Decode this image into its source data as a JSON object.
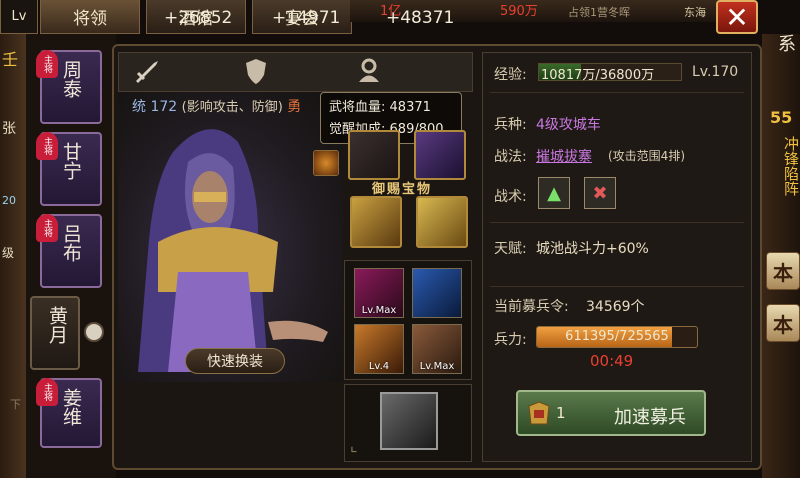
{
  "top_tabs": {
    "generals": "将领",
    "tavern": "酒馆",
    "banquet": "宴会"
  },
  "top_bar": {
    "res1": "1亿",
    "res2": "590万",
    "location": "东海",
    "misc": "占领1营冬晖"
  },
  "corner_labels": {
    "top_left": "Lv",
    "left_top": "壬",
    "left_mid": "张",
    "left_num": "20",
    "left_lvl": "级",
    "left_bottom": "下"
  },
  "hero_list": [
    {
      "name": "周泰",
      "badge": "主将"
    },
    {
      "name": "甘宁",
      "badge": "主将"
    },
    {
      "name": "吕布",
      "badge": "主将"
    },
    {
      "name": "黄月",
      "badge": ""
    },
    {
      "name": "姜维",
      "badge": "主将"
    }
  ],
  "stats": {
    "attack": "+26852",
    "defense": "+14971",
    "hp": "+48371"
  },
  "tongshuai": {
    "label": "统",
    "value": "172",
    "desc": "(影响攻击、防御)",
    "partial": "勇"
  },
  "tooltip": {
    "line1_label": "武将血量:",
    "line1_value": "48371",
    "line2_label": "觉醒加成:",
    "line2_value": "689/800"
  },
  "quick_equip": "快速换装",
  "treasure_label": "御赐宝物",
  "skills": [
    {
      "label": "Lv.Max",
      "name": "skill-1"
    },
    {
      "label": "",
      "name": "skill-2"
    },
    {
      "label": "Lv.4",
      "name": "skill-3"
    },
    {
      "label": "Lv.Max",
      "name": "skill-4"
    }
  ],
  "info": {
    "exp_label": "经验:",
    "exp_value": "10817万/36800万",
    "exp_fraction": 0.294,
    "level": "Lv.170",
    "troop_type_label": "兵种:",
    "troop_type": "4级攻城车",
    "tactic_label": "战法:",
    "tactic": "摧城拔寨",
    "tactic_desc": "(攻击范围4排)",
    "skill_label": "战术:",
    "talent_label": "天赋:",
    "talent": "城池战斗力+60%",
    "recruit_label": "当前募兵令:",
    "recruit_value": "34569个",
    "troops_label": "兵力:",
    "troops_value": "611395/725565",
    "troops_fraction": 0.843,
    "timer": "00:49",
    "speed_count": "1",
    "speed_label": "加速募兵"
  },
  "right_side": {
    "top": "系",
    "num": "55",
    "vert1": "冲锋陷阵",
    "btn1": "本",
    "btn2": "本"
  },
  "colors": {
    "purple": "#c878e0",
    "accent_gold": "#e8c878",
    "timer_red": "#e84030",
    "green_fill": "#3a6a2a",
    "orange_fill": "#f0a040"
  }
}
